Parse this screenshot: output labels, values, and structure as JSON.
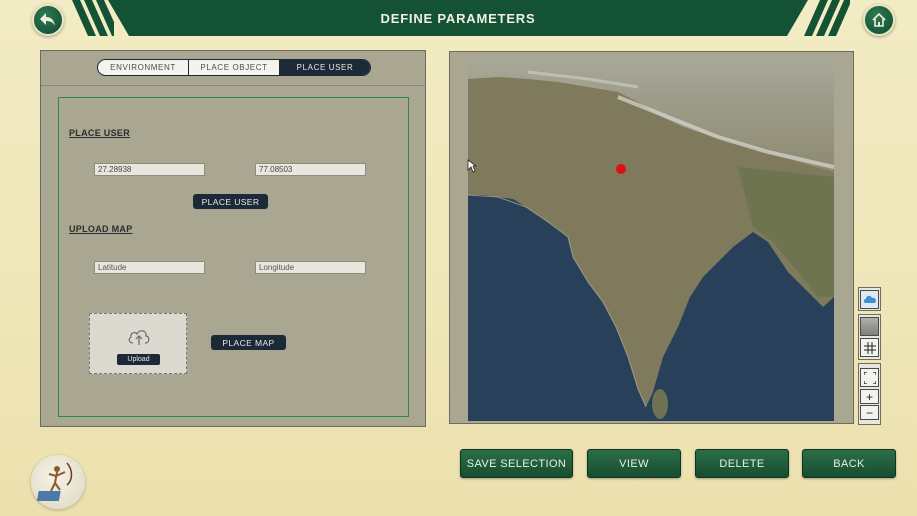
{
  "header": {
    "title": "DEFINE PARAMETERS",
    "back_icon": "back-arrow-icon",
    "home_icon": "home-icon"
  },
  "tabs": [
    {
      "label": "ENVIRONMENT",
      "active": false
    },
    {
      "label": "PLACE OBJECT",
      "active": false
    },
    {
      "label": "PLACE USER",
      "active": true
    }
  ],
  "place_user": {
    "title": "PLACE USER",
    "latitude_value": "27.28938",
    "longitude_value": "77.08503",
    "button_label": "PLACE USER"
  },
  "upload_map": {
    "title": "UPLOAD MAP",
    "latitude_placeholder": "Latitude",
    "longitude_placeholder": "Longitude",
    "upload_label": "Upload",
    "upload_icon": "cloud-upload-icon",
    "button_label": "PLACE MAP"
  },
  "map": {
    "marker_color": "#e01010",
    "tools": [
      "cloud-layer-icon",
      "terrain-layer-icon",
      "grid-icon",
      "fullscreen-icon",
      "zoom-in-icon",
      "zoom-out-icon"
    ]
  },
  "actions": {
    "save_selection": "SAVE SELECTION",
    "view": "VIEW",
    "delete": "DELETE",
    "back": "BACK"
  },
  "colors": {
    "header_green": "#145236",
    "button_green": "#1f5c3c",
    "dark_navy": "#1c2a38",
    "background": "#efe6b8"
  }
}
